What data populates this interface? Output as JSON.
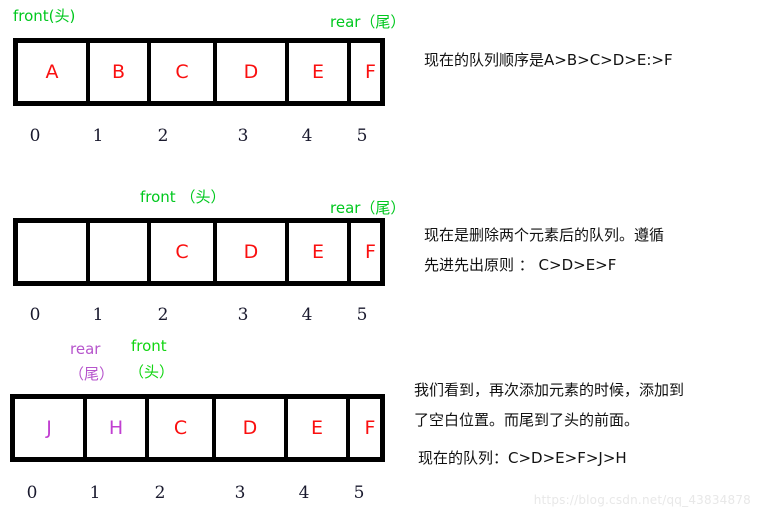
{
  "watermark": "https://blog.csdn.net/qq_43834878",
  "colors": {
    "green": "#00c81e",
    "purple": "#b655cc",
    "red_value": "#fa0f0f",
    "purple_value": "#c13fd1",
    "box_border": "#000000",
    "index_text": "#1a1a2e",
    "note_text": "#111111",
    "watermark": "#e8e8e8"
  },
  "index_labels": [
    "0",
    "1",
    "2",
    "3",
    "4",
    "5"
  ],
  "rows": [
    {
      "id": "row-initial-queue",
      "labels": [
        {
          "name": "front-label",
          "text": "front(头)",
          "color": "green"
        },
        {
          "name": "rear-label",
          "text": "rear（尾）",
          "color": "green"
        }
      ],
      "cells": [
        {
          "value": "A",
          "color": "red"
        },
        {
          "value": "B",
          "color": "red"
        },
        {
          "value": "C",
          "color": "red"
        },
        {
          "value": "D",
          "color": "red"
        },
        {
          "value": "E",
          "color": "red"
        },
        {
          "value": "F",
          "color": "red"
        }
      ],
      "notes": [
        "现在的队列顺序是A>B>C>D>E:>F"
      ]
    },
    {
      "id": "row-after-dequeue",
      "labels": [
        {
          "name": "front-label",
          "text": "front （头）",
          "color": "green"
        },
        {
          "name": "rear-label",
          "text": "rear（尾）",
          "color": "green"
        }
      ],
      "cells": [
        {
          "value": "",
          "color": "red"
        },
        {
          "value": "",
          "color": "red"
        },
        {
          "value": "C",
          "color": "red"
        },
        {
          "value": "D",
          "color": "red"
        },
        {
          "value": "E",
          "color": "red"
        },
        {
          "value": "F",
          "color": "red"
        }
      ],
      "notes": [
        "现在是删除两个元素后的队列。遵循",
        "先进先出原则 ： C>D>E>F"
      ]
    },
    {
      "id": "row-circular-wrap",
      "labels": [
        {
          "name": "rear-label",
          "text": "rear",
          "color": "purple"
        },
        {
          "name": "rear-label-cn",
          "text": "（尾）",
          "color": "purple"
        },
        {
          "name": "front-label",
          "text": "front",
          "color": "green"
        },
        {
          "name": "front-label-cn",
          "text": "（头）",
          "color": "green"
        }
      ],
      "cells": [
        {
          "value": "J",
          "color": "purple"
        },
        {
          "value": "H",
          "color": "purple"
        },
        {
          "value": "C",
          "color": "red"
        },
        {
          "value": "D",
          "color": "red"
        },
        {
          "value": "E",
          "color": "red"
        },
        {
          "value": "F",
          "color": "red"
        }
      ],
      "notes": [
        "我们看到，再次添加元素的时候，添加到",
        "了空白位置。而尾到了头的前面。",
        "现在的队列：C>D>E>F>J>H"
      ]
    }
  ]
}
